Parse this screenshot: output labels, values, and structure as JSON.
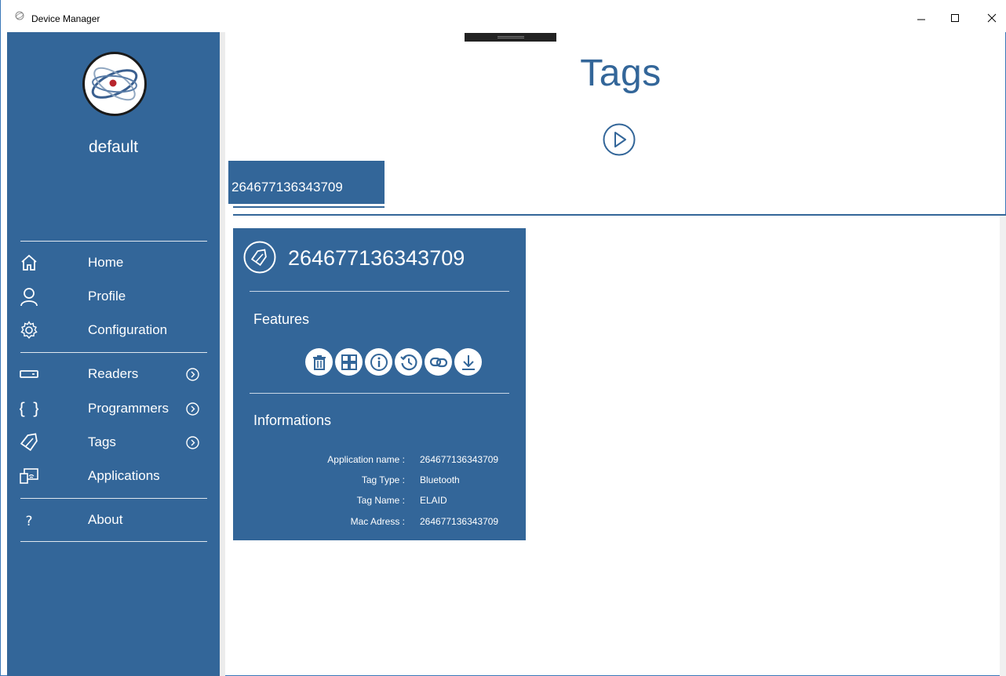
{
  "window": {
    "title": "Device Manager",
    "minimize_icon": "minimize-icon",
    "maximize_icon": "maximize-icon",
    "close_icon": "close-icon"
  },
  "sidebar": {
    "user_name": "default",
    "items": [
      {
        "label": "Home",
        "icon": "home-icon",
        "has_chevron": false
      },
      {
        "label": "Profile",
        "icon": "user-icon",
        "has_chevron": false
      },
      {
        "label": "Configuration",
        "icon": "gear-icon",
        "has_chevron": false
      },
      {
        "label": "Readers",
        "icon": "reader-icon",
        "has_chevron": true
      },
      {
        "label": "Programmers",
        "icon": "braces-icon",
        "has_chevron": true
      },
      {
        "label": "Tags",
        "icon": "tag-icon",
        "has_chevron": true
      },
      {
        "label": "Applications",
        "icon": "applications-icon",
        "has_chevron": false
      },
      {
        "label": "About",
        "icon": "question-icon",
        "has_chevron": false
      }
    ]
  },
  "main": {
    "title": "Tags",
    "tab_label": "264677136343709",
    "card": {
      "title": "264677136343709",
      "features_heading": "Features",
      "features": [
        "trash-icon",
        "grid-icon",
        "info-icon",
        "history-icon",
        "link-icon",
        "download-icon"
      ],
      "informations_heading": "Informations",
      "info": [
        {
          "key": "Application name :",
          "value": "264677136343709"
        },
        {
          "key": "Tag Type :",
          "value": "Bluetooth"
        },
        {
          "key": "Tag Name :",
          "value": "ELAID"
        },
        {
          "key": "Mac Adress :",
          "value": "264677136343709"
        }
      ]
    }
  },
  "colors": {
    "primary": "#336699",
    "white": "#ffffff"
  }
}
